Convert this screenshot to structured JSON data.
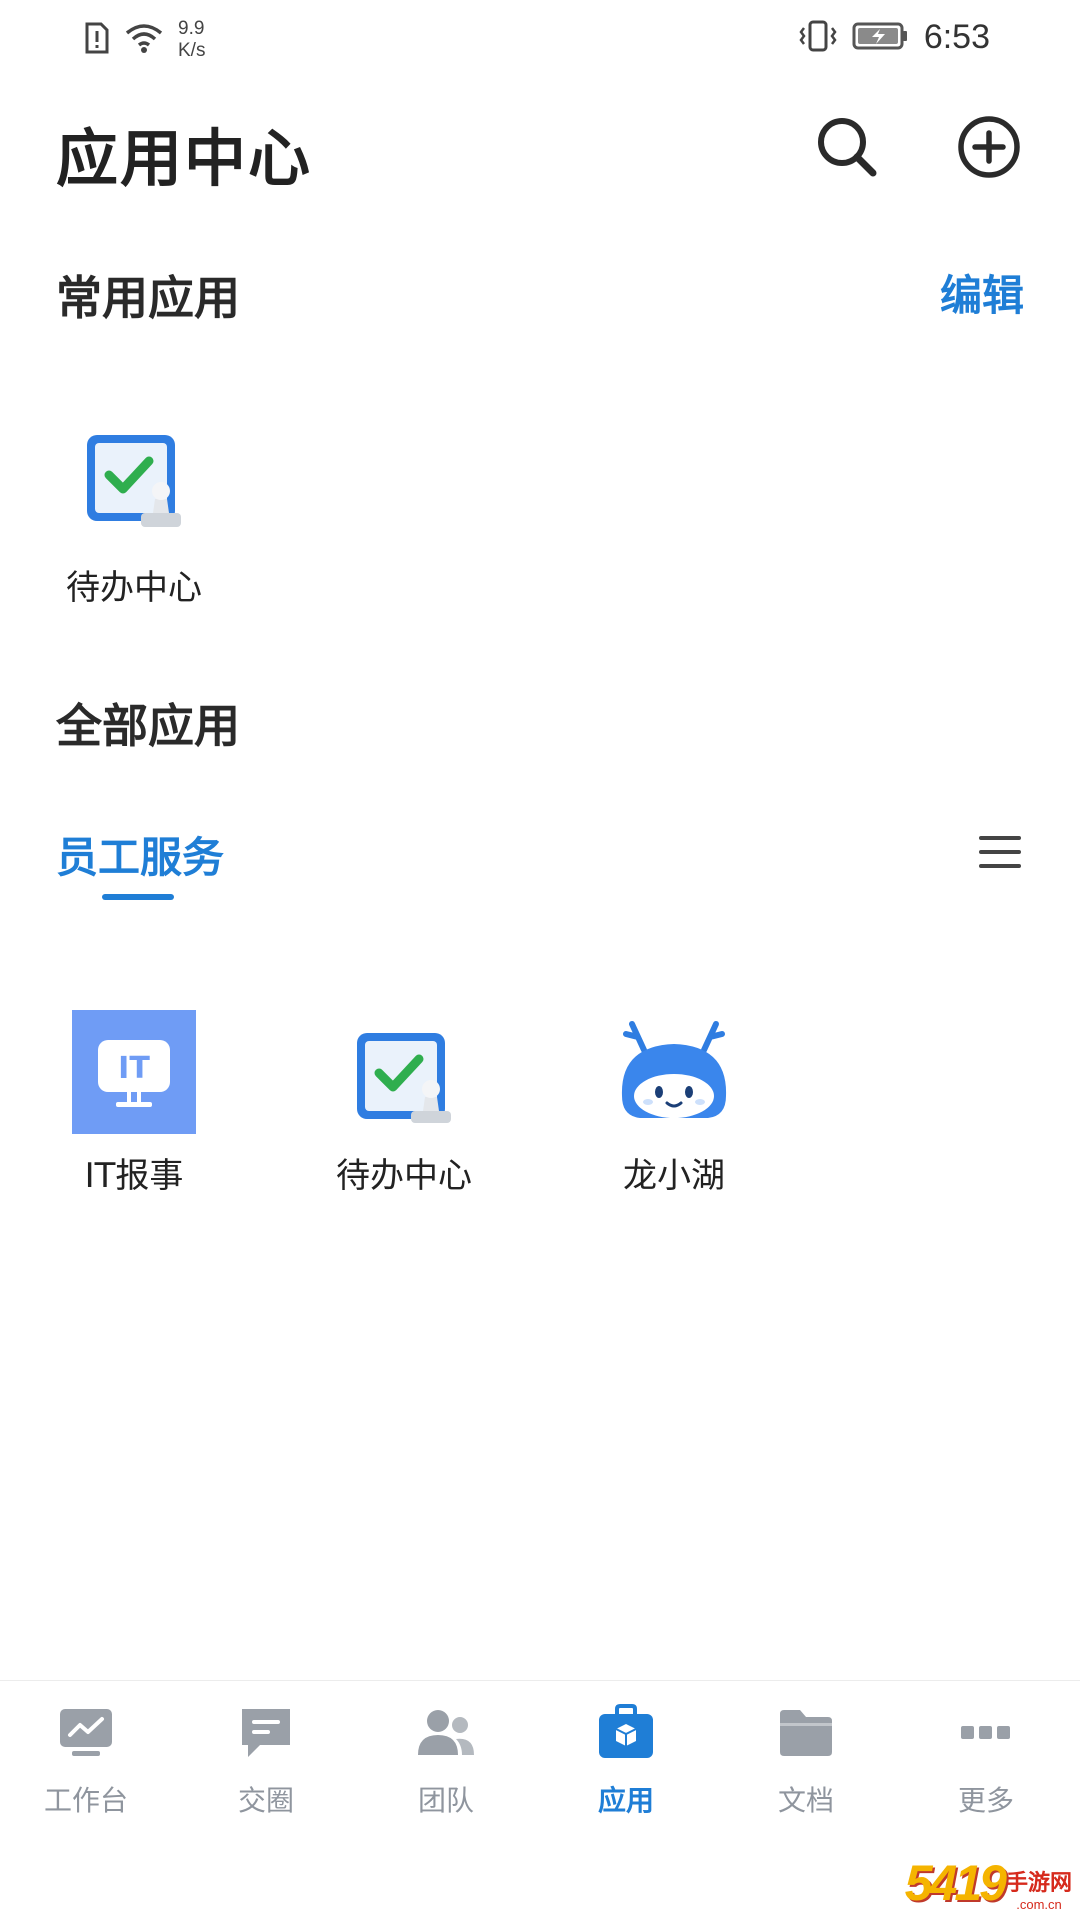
{
  "status_bar": {
    "net_speed_value": "9.9",
    "net_speed_unit": "K/s",
    "time": "6:53"
  },
  "header": {
    "title": "应用中心"
  },
  "common_apps": {
    "title": "常用应用",
    "edit_label": "编辑",
    "items": [
      {
        "label": "待办中心",
        "icon": "todo-center-icon"
      }
    ]
  },
  "all_apps": {
    "title": "全部应用",
    "category_tab": "员工服务",
    "items": [
      {
        "label": "IT报事",
        "icon": "it-report-icon"
      },
      {
        "label": "待办中心",
        "icon": "todo-center-icon"
      },
      {
        "label": "龙小湖",
        "icon": "dragon-mascot-icon"
      }
    ]
  },
  "bottom_nav": {
    "items": [
      {
        "label": "工作台",
        "icon": "workbench-icon"
      },
      {
        "label": "交圈",
        "icon": "chat-icon"
      },
      {
        "label": "团队",
        "icon": "team-icon"
      },
      {
        "label": "应用",
        "icon": "apps-icon",
        "active": true
      },
      {
        "label": "文档",
        "icon": "folder-icon"
      },
      {
        "label": "更多",
        "icon": "more-icon"
      }
    ]
  },
  "colors": {
    "accent": "#1f7ed6",
    "nav_inactive": "#8f959e",
    "text": "#222222"
  },
  "watermark": {
    "digits": "5419",
    "cn": "手游网",
    "url": ".com.cn"
  }
}
